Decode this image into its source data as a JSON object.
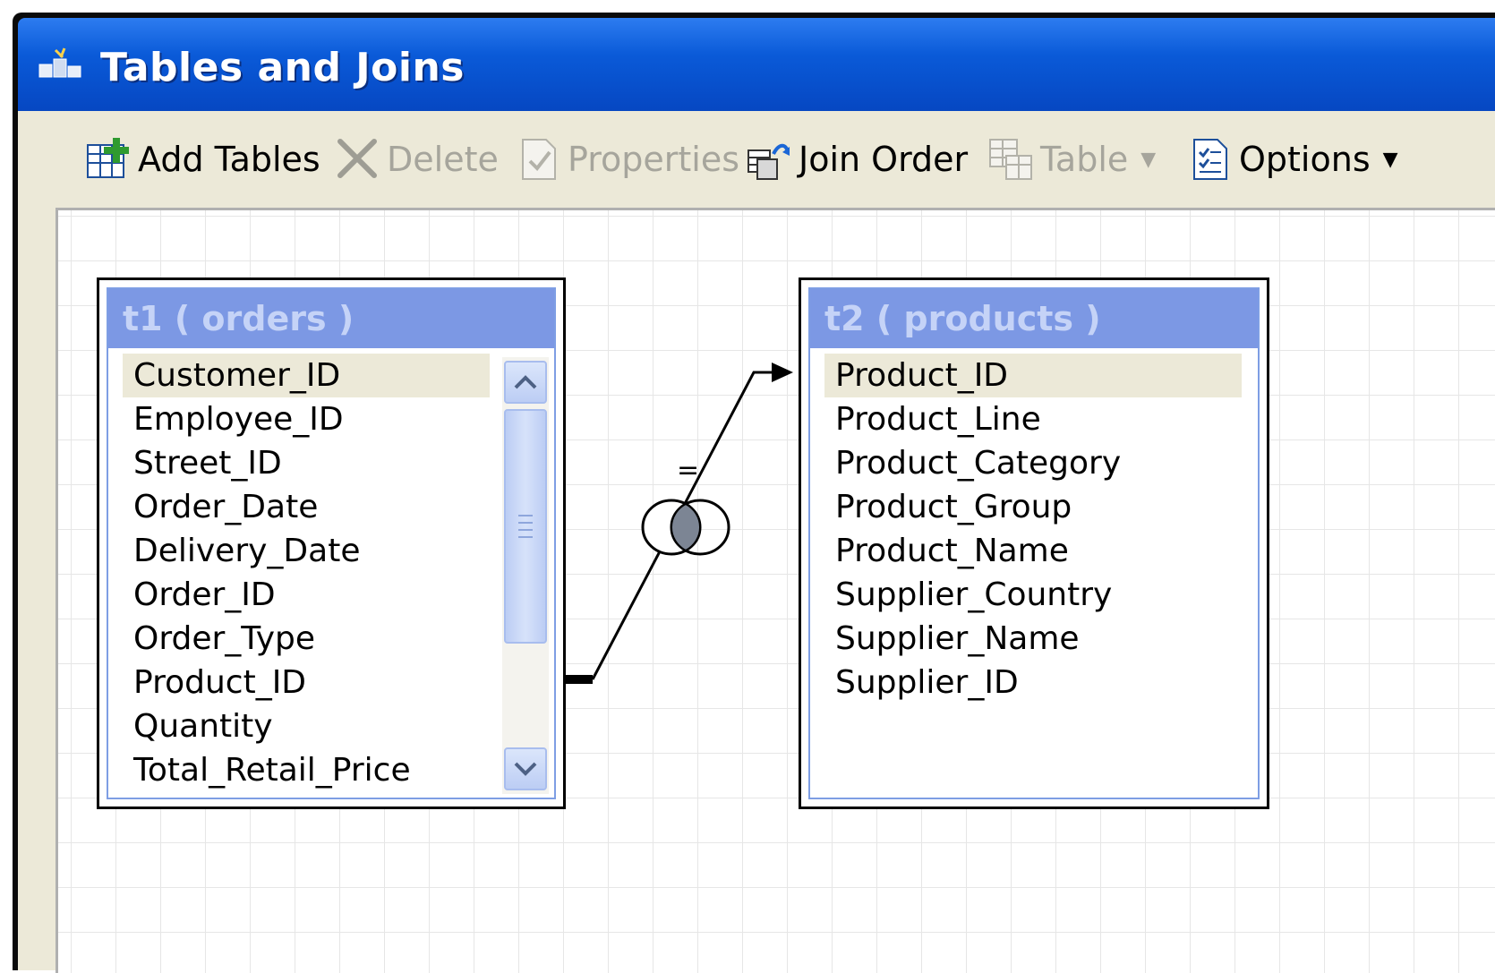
{
  "window": {
    "title": "Tables and Joins",
    "icon": "tables-joins-icon"
  },
  "toolbar": {
    "items": [
      {
        "label": "Add Tables",
        "icon": "add-tables-icon",
        "enabled": true
      },
      {
        "label": "Delete",
        "icon": "delete-x-icon",
        "enabled": false
      },
      {
        "label": "Properties",
        "icon": "properties-icon",
        "enabled": false
      },
      {
        "label": "Join Order",
        "icon": "join-order-icon",
        "enabled": true
      },
      {
        "label": "Table",
        "icon": "table-icon",
        "enabled": false,
        "dropdown": true
      },
      {
        "label": "Options",
        "icon": "options-icon",
        "enabled": true,
        "dropdown": true
      }
    ]
  },
  "tables": {
    "t1": {
      "title": "t1 ( orders )",
      "columns": [
        "Customer_ID",
        "Employee_ID",
        "Street_ID",
        "Order_Date",
        "Delivery_Date",
        "Order_ID",
        "Order_Type",
        "Product_ID",
        "Quantity",
        "Total_Retail_Price"
      ],
      "selected": "Customer_ID"
    },
    "t2": {
      "title": "t2 ( products )",
      "columns": [
        "Product_ID",
        "Product_Line",
        "Product_Category",
        "Product_Group",
        "Product_Name",
        "Supplier_Country",
        "Supplier_Name",
        "Supplier_ID"
      ],
      "selected": "Product_ID"
    }
  },
  "join": {
    "operator": "=",
    "type_icon": "inner-join-venn-icon",
    "from": "t1.Product_ID",
    "to": "t2.Product_ID"
  },
  "colors": {
    "titlebar": "#0a5ad8",
    "table_header": "#7c98e4",
    "frame": "#ece9d8"
  }
}
